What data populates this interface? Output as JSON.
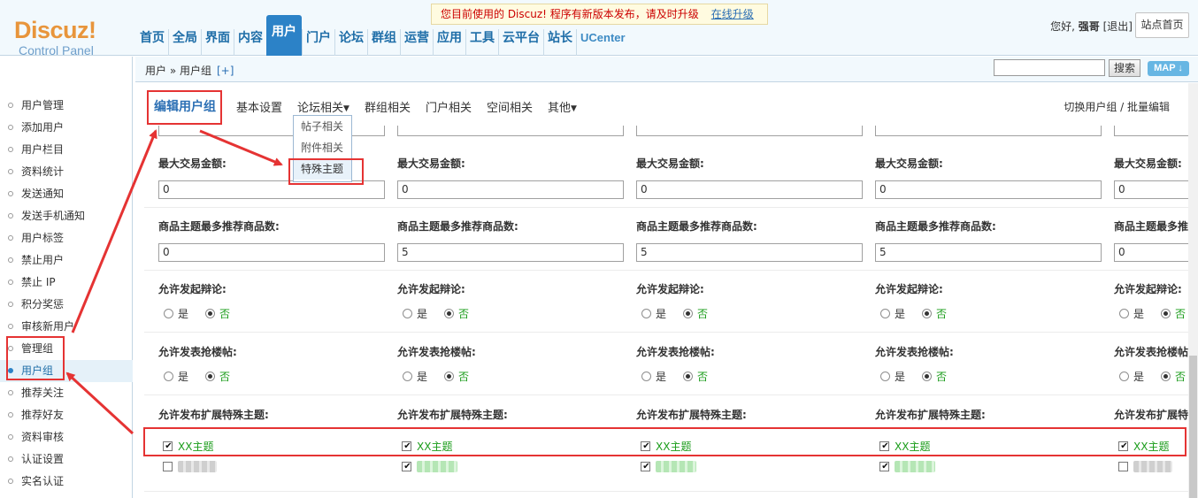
{
  "logo": {
    "brand": "Discuz!",
    "sub": "Control Panel"
  },
  "topnav": [
    "首页",
    "全局",
    "界面",
    "内容",
    "用户",
    "门户",
    "论坛",
    "群组",
    "运营",
    "应用",
    "工具",
    "云平台",
    "站长",
    "UCenter"
  ],
  "topnav_active": "用户",
  "notice": {
    "text": "您目前使用的 Discuz! 程序有新版本发布，请及时升级",
    "link": "在线升级"
  },
  "user": {
    "greeting": "您好,",
    "name": "强哥",
    "logout": "[退出]",
    "site_home": "站点首页"
  },
  "breadcrumb": {
    "path": "用户 » 用户组",
    "plus": "[+]"
  },
  "search": {
    "button": "搜索",
    "map": "MAP ↓"
  },
  "sidebar": [
    "用户管理",
    "添加用户",
    "用户栏目",
    "资料统计",
    "发送通知",
    "发送手机通知",
    "用户标签",
    "禁止用户",
    "禁止 IP",
    "积分奖惩",
    "审核新用户",
    "管理组",
    "用户组",
    "推荐关注",
    "推荐好友",
    "资料审核",
    "认证设置",
    "实名认证"
  ],
  "sidebar_current": "用户组",
  "tabs": {
    "edit": "编辑用户组",
    "basic": "基本设置",
    "forum": "论坛相关",
    "group": "群组相关",
    "portal": "门户相关",
    "space": "空间相关",
    "other": "其他",
    "switch": "切换用户组 / 批量编辑"
  },
  "dropdown": [
    "帖子相关",
    "附件相关",
    "特殊主题"
  ],
  "fields": {
    "max_trade": "最大交易金额:",
    "goods_recommend": "商品主题最多推荐商品数:",
    "allow_debate": "允许发起辩论:",
    "allow_rush": "允许发表抢楼帖:",
    "allow_ext": "允许发布扩展特殊主题:",
    "yes": "是",
    "no": "否",
    "xx_topic": "XX主题"
  },
  "columns": [
    {
      "max_trade": "0",
      "goods": "0",
      "debate": "no",
      "rush": "no",
      "xx": true,
      "other": false
    },
    {
      "max_trade": "0",
      "goods": "5",
      "debate": "no",
      "rush": "no",
      "xx": true,
      "other": true
    },
    {
      "max_trade": "0",
      "goods": "5",
      "debate": "no",
      "rush": "no",
      "xx": true,
      "other": true
    },
    {
      "max_trade": "0",
      "goods": "5",
      "debate": "no",
      "rush": "no",
      "xx": true,
      "other": true
    },
    {
      "max_trade": "0",
      "goods": "0",
      "debate": "no",
      "rush": "no",
      "xx": true,
      "other": false
    }
  ],
  "colors": {
    "accent": "#2c82c7",
    "annotation": "#e53333",
    "green": "#1a9c1a",
    "logo_orange": "#e8953b"
  }
}
